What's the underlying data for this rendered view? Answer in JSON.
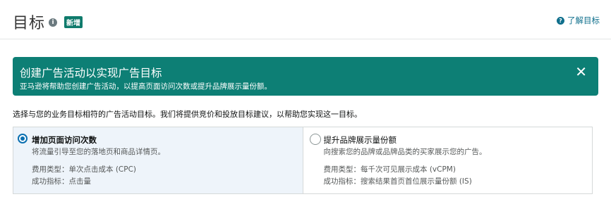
{
  "header": {
    "title": "目标",
    "info_icon": "i",
    "new_badge": "新增",
    "learn_link": "了解目标",
    "learn_icon": "?"
  },
  "banner": {
    "title": "创建广告活动以实现广告目标",
    "subtitle": "亚马逊将帮助您创建广告活动，以提高页面访问次数或提升品牌展示量份额。",
    "close_icon": "✕",
    "color": "#0d7f75"
  },
  "instruction": "选择与您的业务目标相符的广告活动目标。我们将提供竞价和投放目标建议，以帮助您实现这一目标。",
  "goals": [
    {
      "title": "增加页面访问次数",
      "description": "将流量引导至您的落地页和商品详情页。",
      "cost_type": "费用类型：单次点击成本 (CPC)",
      "success_metric": "成功指标：点击量",
      "selected": true
    },
    {
      "title": "提升品牌展示量份额",
      "description": "向搜索您的品牌或品牌品类的买家展示您的广告。",
      "cost_type": "费用类型：每千次可见展示成本 (vCPM)",
      "success_metric": "成功指标：搜索结果首页首位展示量份额 (IS)",
      "selected": false
    }
  ]
}
